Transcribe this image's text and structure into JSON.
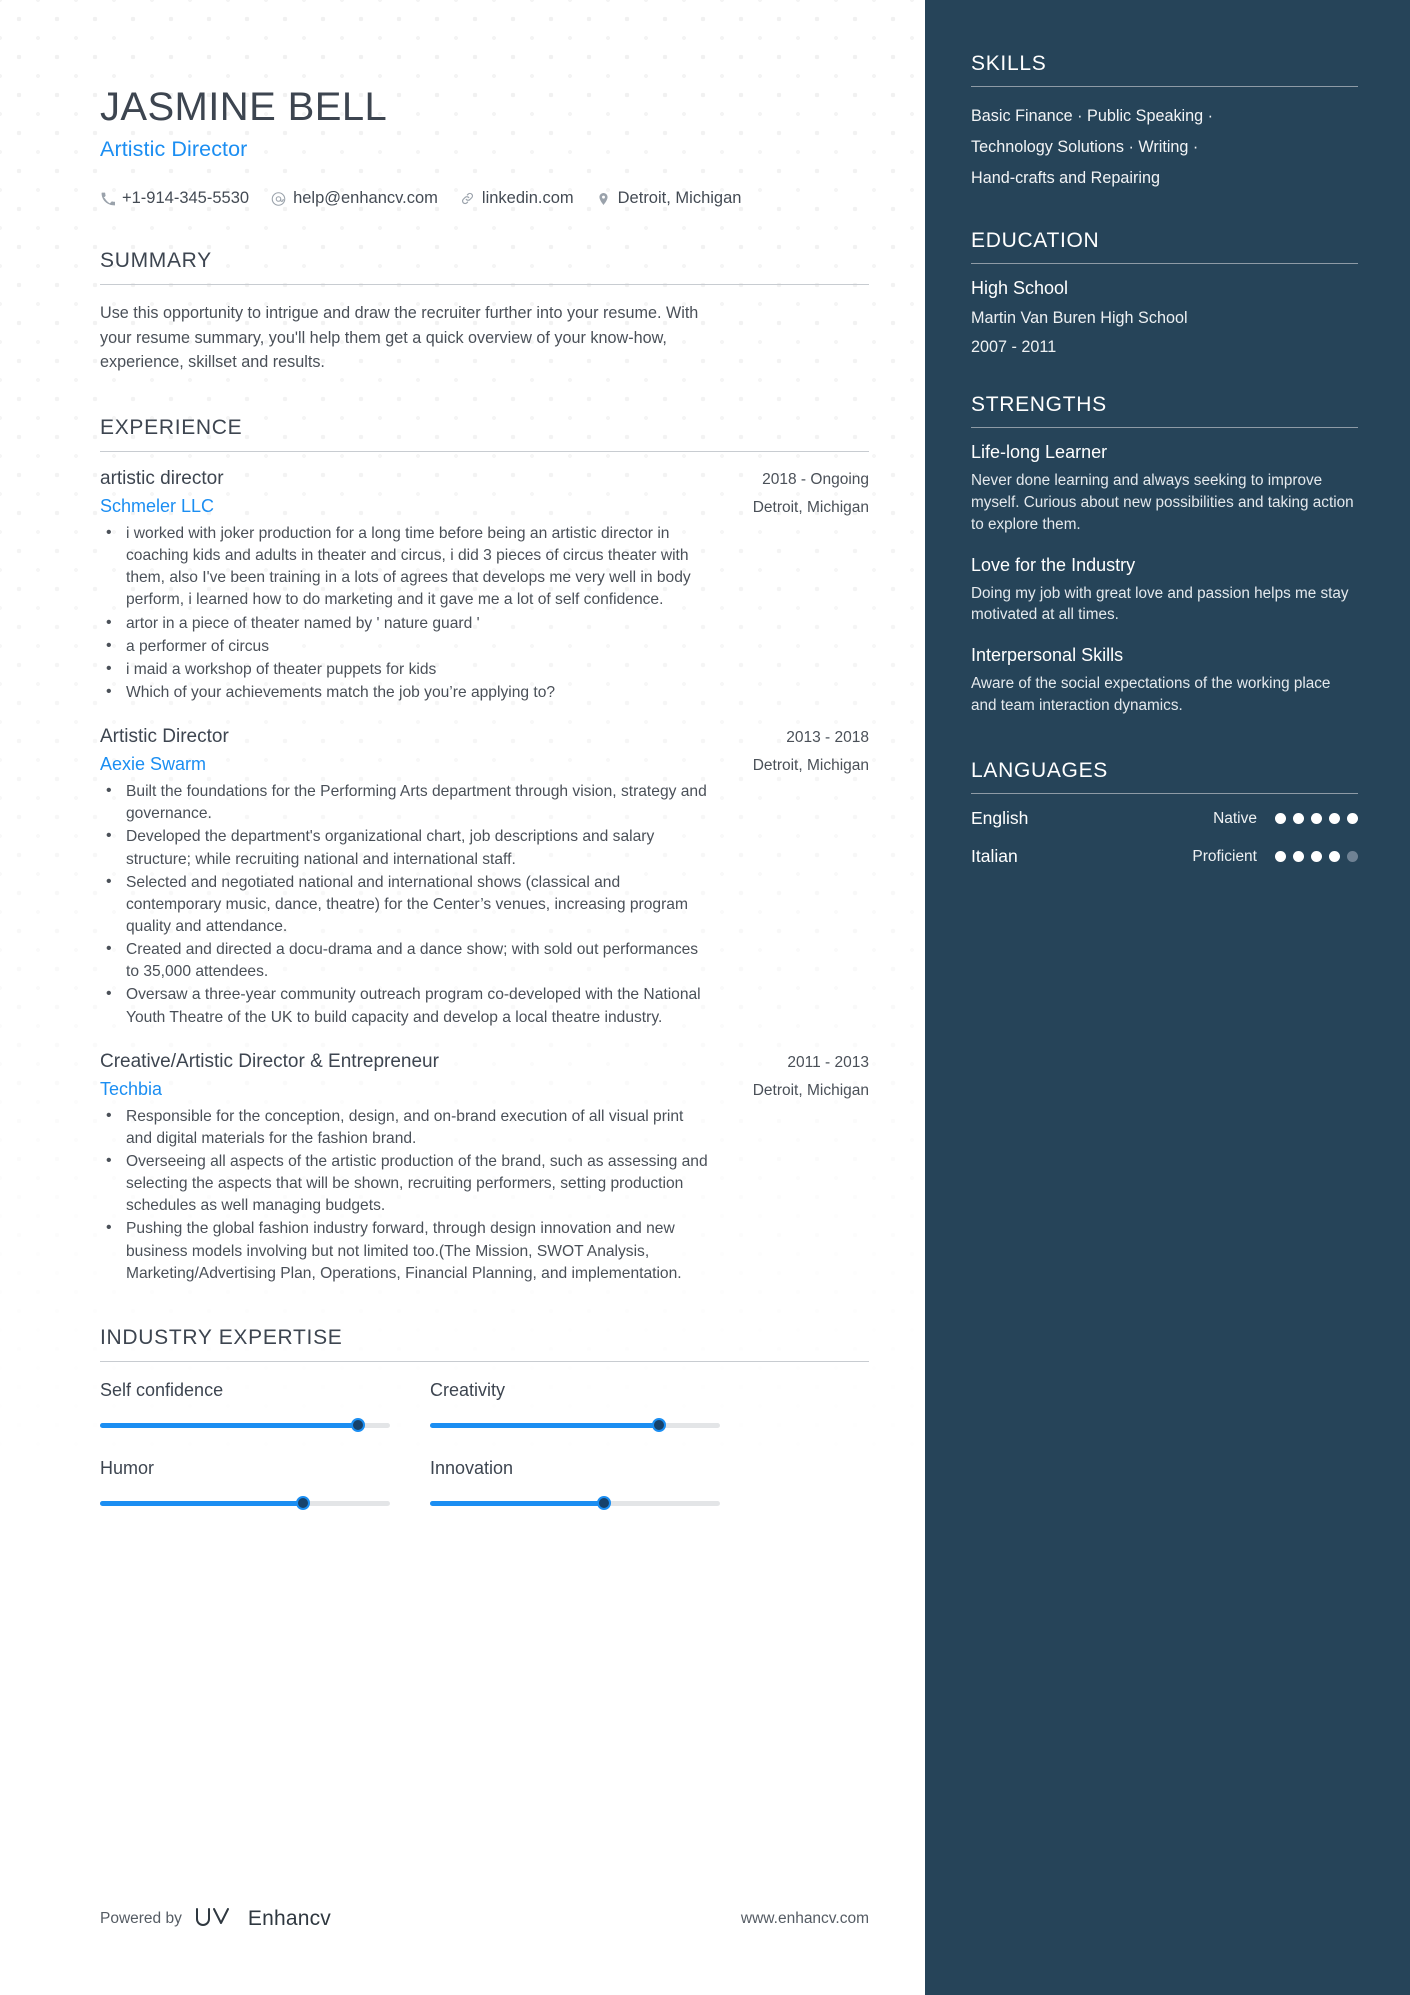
{
  "header": {
    "name": "JASMINE BELL",
    "title": "Artistic Director",
    "contacts": [
      {
        "icon": "phone-icon",
        "value": "+1-914-345-5530"
      },
      {
        "icon": "email-icon",
        "value": "help@enhancv.com"
      },
      {
        "icon": "link-icon",
        "value": "linkedin.com"
      },
      {
        "icon": "location-pin-icon",
        "value": "Detroit, Michigan"
      }
    ]
  },
  "summary": {
    "heading": "SUMMARY",
    "text": "Use this opportunity to intrigue and draw the recruiter further into your resume. With your resume summary, you'll help them get a quick overview of your know-how, experience, skillset and results."
  },
  "experience": {
    "heading": "EXPERIENCE",
    "jobs": [
      {
        "role": "artistic director",
        "dates": "2018 - Ongoing",
        "company": "Schmeler LLC",
        "location": "Detroit, Michigan",
        "bullets": [
          " i worked with joker production for a long time before being an artistic director in coaching kids and adults in theater and circus, i did 3 pieces of circus theater with them, also I've been training in a lots of agrees that develops me very well in body perform, i learned how to do marketing and it gave me a lot of self confidence.",
          "artor in a piece of theater named by ' nature guard '",
          "a performer of circus",
          "i maid a workshop of theater puppets for kids",
          "Which of your achievements match the job you’re applying to?"
        ]
      },
      {
        "role": "Artistic Director",
        "dates": "2013 - 2018",
        "company": "Aexie Swarm",
        "location": "Detroit, Michigan",
        "bullets": [
          "Built the foundations for the Performing Arts department through vision, strategy and governance.",
          "Developed the department's organizational chart, job descriptions and salary structure; while recruiting national and international staff.",
          "Selected and negotiated national and international shows (classical and contemporary music, dance, theatre) for the Center’s venues, increasing program quality and attendance.",
          "Created and directed a docu-drama and a dance show; with sold out performances to 35,000 attendees.",
          "Oversaw a three-year community outreach program co-developed with the National Youth Theatre of the UK to build capacity and develop a local theatre industry."
        ]
      },
      {
        "role": "Creative/Artistic Director & Entrepreneur",
        "dates": "2011 - 2013",
        "company": "Techbia",
        "location": "Detroit, Michigan",
        "bullets": [
          "Responsible for the conception, design, and on-brand execution of all visual print and digital materials for the fashion brand.",
          "Overseeing all aspects of the artistic production of the brand, such as assessing and selecting the aspects that will be shown, recruiting performers, setting production schedules as well managing budgets.",
          "Pushing the global fashion industry forward, through design innovation and new business models involving but not limited too.(The Mission, SWOT Analysis, Marketing/Advertising Plan, Operations, Financial Planning, and implementation."
        ]
      }
    ]
  },
  "industry_expertise": {
    "heading": "INDUSTRY EXPERTISE",
    "items": [
      {
        "label": "Self confidence",
        "percent": 89
      },
      {
        "label": "Creativity",
        "percent": 79
      },
      {
        "label": "Humor",
        "percent": 70
      },
      {
        "label": "Innovation",
        "percent": 60
      }
    ]
  },
  "footer": {
    "powered_by": "Powered by",
    "brand": "Enhancv",
    "url": "www.enhancv.com"
  },
  "sidebar": {
    "skills": {
      "heading": "SKILLS",
      "lines": [
        "Basic Finance · Public Speaking ·",
        "Technology Solutions · Writing ·",
        "Hand-crafts and Repairing"
      ]
    },
    "education": {
      "heading": "EDUCATION",
      "degree": "High School",
      "school": "Martin Van Buren High School",
      "dates": "2007 - 2011"
    },
    "strengths": {
      "heading": "STRENGTHS",
      "items": [
        {
          "title": "Life-long Learner",
          "desc": "Never done learning and always seeking to improve myself. Curious about new possibilities and taking action to explore them."
        },
        {
          "title": "Love for the Industry",
          "desc": "Doing my job with great love and passion helps me stay motivated at all times."
        },
        {
          "title": "Interpersonal Skills",
          "desc": "Aware of the social expectations of the working place and team interaction dynamics."
        }
      ]
    },
    "languages": {
      "heading": "LANGUAGES",
      "items": [
        {
          "name": "English",
          "level": "Native",
          "filled": 5,
          "total": 5
        },
        {
          "name": "Italian",
          "level": "Proficient",
          "filled": 4,
          "total": 5
        }
      ]
    }
  },
  "colors": {
    "accent": "#1b8ef2",
    "sidebar_bg": "#264459",
    "text": "#4a5058"
  }
}
